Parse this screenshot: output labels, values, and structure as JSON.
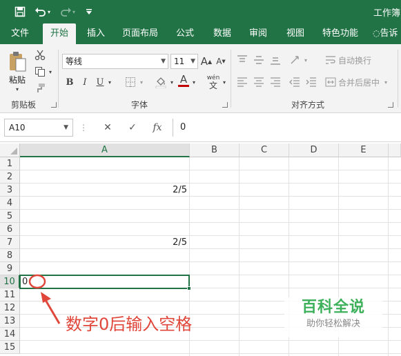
{
  "title_bar": {
    "save_icon": "save-icon",
    "undo_icon": "undo-icon",
    "redo_icon": "redo-icon",
    "customize_icon": "customize-qat-icon",
    "window_title": "工作簿"
  },
  "tabs": [
    "文件",
    "开始",
    "插入",
    "页面布局",
    "公式",
    "数据",
    "审阅",
    "视图",
    "特色功能",
    "告诉"
  ],
  "active_tab": "开始",
  "ribbon": {
    "clipboard": {
      "paste_label": "粘贴",
      "group_label": "剪贴板"
    },
    "font": {
      "font_name": "等线",
      "font_size": "11",
      "bold": "B",
      "italic": "I",
      "underline": "U",
      "increase_size": "A",
      "decrease_size": "A",
      "pinyin": "wén",
      "pinyin_sub": "文",
      "font_color_glyph": "A",
      "group_label": "字体"
    },
    "alignment": {
      "wrap_text": "自动换行",
      "merge_center": "合并后居中",
      "group_label": "对齐方式"
    }
  },
  "formula_bar": {
    "name_box": "A10",
    "cancel_glyph": "✕",
    "enter_glyph": "✓",
    "fx_glyph": "fx",
    "formula": "0"
  },
  "grid": {
    "columns": [
      "A",
      "B",
      "C",
      "D",
      "E"
    ],
    "selected_column": "A",
    "rows": [
      "1",
      "2",
      "3",
      "4",
      "5",
      "6",
      "7",
      "8",
      "9",
      "10",
      "11",
      "12",
      "13",
      "14",
      "15"
    ],
    "selected_row": "10",
    "cells": {
      "A3": "2/5",
      "A7": "2/5",
      "A10": "0"
    }
  },
  "annotation": {
    "text": "数字0后输入空格",
    "color": "#e0473a"
  },
  "watermark": {
    "title": "百科全说",
    "subtitle": "助你轻松解决"
  },
  "colors": {
    "brand": "#217346",
    "ribbon_bg": "#f3f3f3",
    "font_color_bar": "#c00000"
  }
}
